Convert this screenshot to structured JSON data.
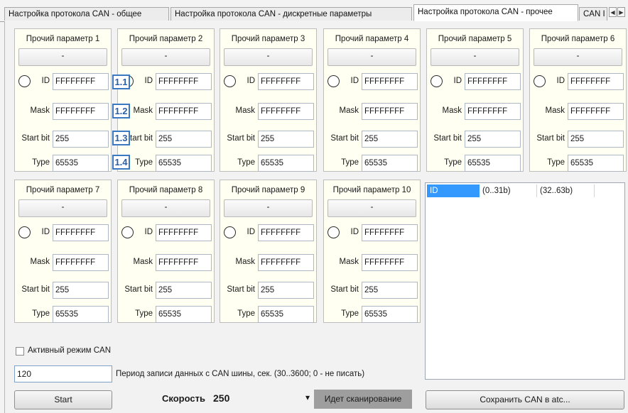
{
  "tabs": [
    {
      "label": "Настройка протокола CAN - общее",
      "active": false
    },
    {
      "label": "Настройка протокола CAN - дискретные параметры",
      "active": false
    },
    {
      "label": "Настройка протокола CAN - прочее",
      "active": true
    },
    {
      "label": "CAN I",
      "active": false
    }
  ],
  "tab_scroll": {
    "left": "◀",
    "right": "▶"
  },
  "field_labels": {
    "id": "ID",
    "mask": "Mask",
    "start_bit": "Start bit",
    "type": "Type"
  },
  "params": [
    {
      "title": "Прочий параметр 1",
      "value": "-",
      "id": "FFFFFFFF",
      "mask": "FFFFFFFF",
      "start_bit": "255",
      "type": "65535"
    },
    {
      "title": "Прочий параметр 2",
      "value": "-",
      "id": "FFFFFFFF",
      "mask": "FFFFFFFF",
      "start_bit": "255",
      "type": "65535"
    },
    {
      "title": "Прочий параметр 3",
      "value": "-",
      "id": "FFFFFFFF",
      "mask": "FFFFFFFF",
      "start_bit": "255",
      "type": "65535"
    },
    {
      "title": "Прочий параметр 4",
      "value": "-",
      "id": "FFFFFFFF",
      "mask": "FFFFFFFF",
      "start_bit": "255",
      "type": "65535"
    },
    {
      "title": "Прочий параметр 5",
      "value": "-",
      "id": "FFFFFFFF",
      "mask": "FFFFFFFF",
      "start_bit": "255",
      "type": "65535"
    },
    {
      "title": "Прочий параметр 6",
      "value": "-",
      "id": "FFFFFFFF",
      "mask": "FFFFFFFF",
      "start_bit": "255",
      "type": "65535"
    },
    {
      "title": "Прочий параметр 7",
      "value": "-",
      "id": "FFFFFFFF",
      "mask": "FFFFFFFF",
      "start_bit": "255",
      "type": "65535"
    },
    {
      "title": "Прочий параметр 8",
      "value": "-",
      "id": "FFFFFFFF",
      "mask": "FFFFFFFF",
      "start_bit": "255",
      "type": "65535"
    },
    {
      "title": "Прочий параметр 9",
      "value": "-",
      "id": "FFFFFFFF",
      "mask": "FFFFFFFF",
      "start_bit": "255",
      "type": "65535"
    },
    {
      "title": "Прочий параметр 10",
      "value": "-",
      "id": "FFFFFFFF",
      "mask": "FFFFFFFF",
      "start_bit": "255",
      "type": "65535"
    }
  ],
  "callouts": [
    "1.1",
    "1.2",
    "1.3",
    "1.4"
  ],
  "list": {
    "columns": [
      "ID",
      "(0..31b)",
      "(32..63b)"
    ]
  },
  "active_mode_label": "Активный режим CAN",
  "active_mode_checked": false,
  "period": {
    "value": "120",
    "label": "Период записи данных с CAN шины, сек. (30..3600; 0 - не писать)"
  },
  "start_button": "Start",
  "speed": {
    "label": "Скорость",
    "value": "250",
    "arrow": "▾"
  },
  "status": "Идет сканирование",
  "save_button": "Сохранить CAN в atc..."
}
